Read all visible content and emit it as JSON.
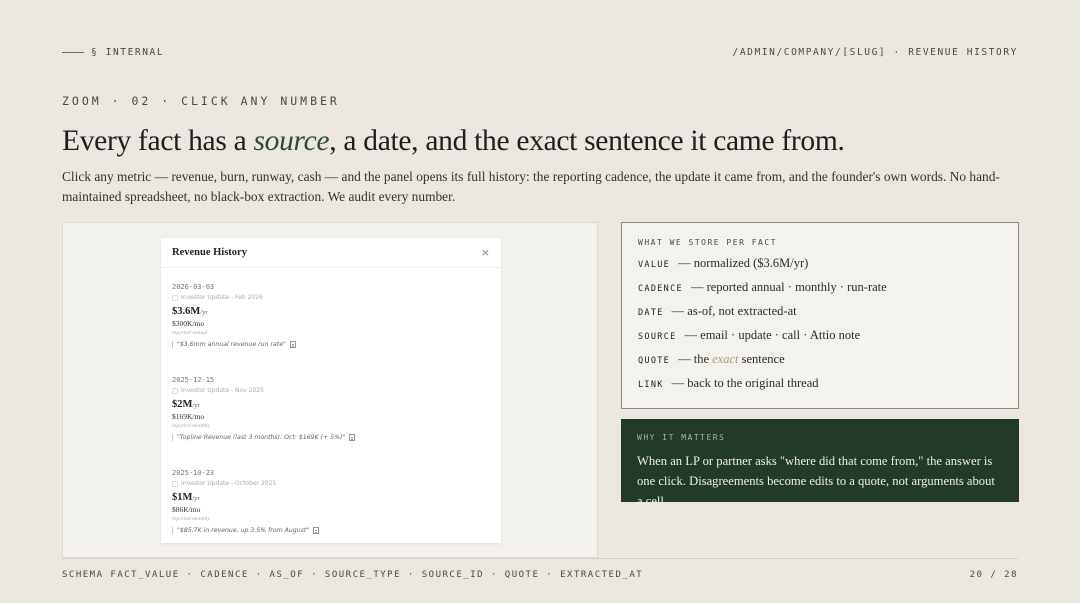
{
  "header": {
    "section": "§ INTERNAL",
    "path": "/ADMIN/COMPANY/[SLUG] · REVENUE HISTORY"
  },
  "eyebrow": "ZOOM · 02 · CLICK ANY NUMBER",
  "headline": {
    "before": "Every fact has a ",
    "emphasis": "source",
    "after": ", a date, and the exact sentence it came from."
  },
  "lead": "Click any metric — revenue, burn, runway, cash — and the panel opens its full history: the reporting cadence, the update it came from, and the founder's own words. No hand-maintained spreadsheet, no black-box extraction. We audit every number.",
  "modal": {
    "title": "Revenue History",
    "close": "×",
    "entries": [
      {
        "date": "2026-03-03",
        "source": "Investor Update - Feb 2026",
        "value": "$3.6M",
        "unit": "/yr",
        "monthly": "$300K/mo",
        "cadence": "reported annual",
        "quote": "\"$3.6mm annual revenue run rate\""
      },
      {
        "date": "2025-12-15",
        "source": "Investor Update - Nov 2025",
        "value": "$2M",
        "unit": "/yr",
        "monthly": "$169K/mo",
        "cadence": "reported monthly",
        "quote": "\"Topline Revenue (last 3 months): Oct: $169K (+ 5%)\""
      },
      {
        "date": "2025-10-23",
        "source": "Investor Update - October 2025",
        "value": "$1M",
        "unit": "/yr",
        "monthly": "$86K/mo",
        "cadence": "reported monthly",
        "quote": "\"$85.7K in revenue, up 3.5% from August\""
      }
    ]
  },
  "store": {
    "title": "WHAT WE STORE PER FACT",
    "fields": [
      {
        "key": "VALUE",
        "desc": "— normalized ($3.6M/yr)"
      },
      {
        "key": "CADENCE",
        "desc": "— reported annual · monthly · run-rate"
      },
      {
        "key": "DATE",
        "desc": "— as-of, not extracted-at"
      },
      {
        "key": "SOURCE",
        "desc": "— email · update · call · Attio note"
      },
      {
        "key": "QUOTE",
        "desc_before": "— the ",
        "desc_em": "exact",
        "desc_after": " sentence"
      },
      {
        "key": "LINK",
        "desc": "— back to the original thread"
      }
    ]
  },
  "why": {
    "title": "WHY IT MATTERS",
    "body": "When an LP or partner asks \"where did that come from,\" the answer is one click. Disagreements become edits to a quote, not arguments about a cell."
  },
  "footer": {
    "schema": "SCHEMA FACT_VALUE · CADENCE · AS_OF · SOURCE_TYPE · SOURCE_ID · QUOTE · EXTRACTED_AT",
    "page": "20 / 28"
  }
}
